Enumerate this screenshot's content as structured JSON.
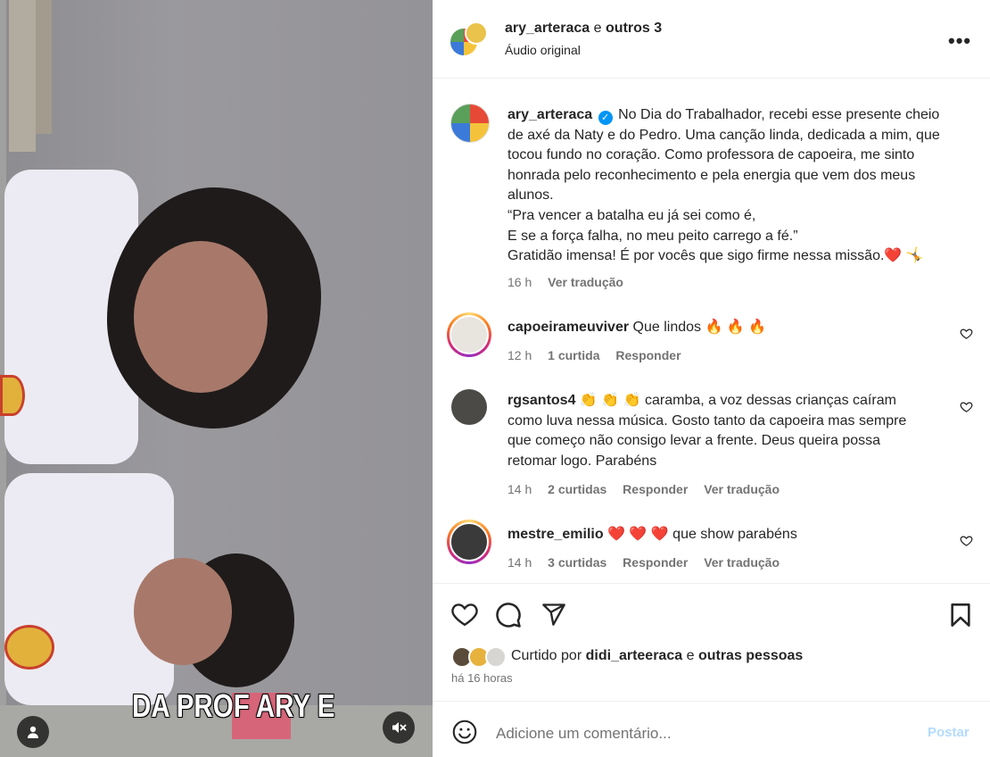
{
  "video": {
    "caption": "DA PROF ARY E"
  },
  "header": {
    "username": "ary_arteraca",
    "joiner": "e",
    "others": "outros 3",
    "subtitle": "Áudio original"
  },
  "caption_post": {
    "username": "ary_arteraca",
    "lines": [
      "No Dia do Trabalhador, recebi esse presente cheio",
      "de axé da Naty e do Pedro. Uma canção linda, dedicada a mim, que",
      "tocou fundo no coração. Como professora de capoeira, me sinto",
      "honrada pelo reconhecimento e pela energia que vem dos meus",
      "alunos.",
      "“Pra vencer a batalha eu já sei como é,",
      "E se a força falha, no meu peito carrego a fé.”",
      "Gratidão imensa! É por vocês que sigo firme nessa missão.❤️ 🤸"
    ],
    "time": "16 h",
    "translate": "Ver tradução"
  },
  "comments": [
    {
      "username": "capoeirameuviver",
      "lines": [
        "Que lindos 🔥 🔥 🔥"
      ],
      "time": "12 h",
      "likes": "1 curtida",
      "reply": "Responder",
      "translate": ""
    },
    {
      "username": "rgsantos4",
      "lines": [
        "👏 👏 👏 caramba, a voz dessas crianças caíram",
        "como luva nessa música. Gosto tanto da capoeira mas sempre",
        "que começo não consigo levar a frente. Deus queira possa",
        "retomar logo. Parabéns"
      ],
      "time": "14 h",
      "likes": "2 curtidas",
      "reply": "Responder",
      "translate": "Ver tradução"
    },
    {
      "username": "mestre_emilio",
      "lines": [
        "❤️ ❤️ ❤️ que show parabéns"
      ],
      "time": "14 h",
      "likes": "3 curtidas",
      "reply": "Responder",
      "translate": "Ver tradução"
    }
  ],
  "likes_line": {
    "prefix": "Curtido por",
    "user": "didi_arteeraca",
    "joiner": "e",
    "others": "outras pessoas"
  },
  "post_time": "há 16 horas",
  "composer": {
    "placeholder": "Adicione um comentário...",
    "post_label": "Postar"
  },
  "colors": {
    "verified": "#0095f6",
    "link_disabled": "#b3dbff",
    "secondary_text": "#737373"
  }
}
